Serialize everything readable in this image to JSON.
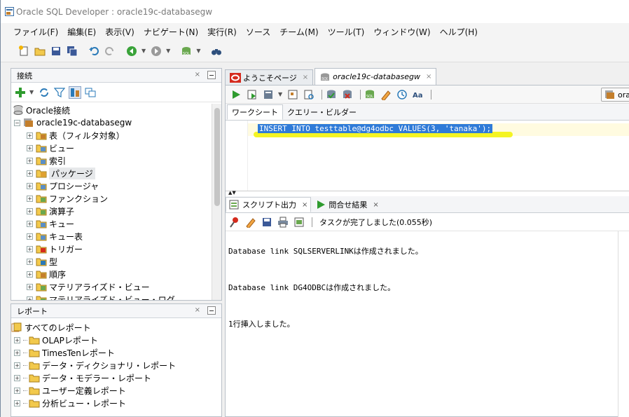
{
  "window": {
    "title": "Oracle SQL Developer : oracle19c-databasegw"
  },
  "menubar": [
    "ファイル(F)",
    "編集(E)",
    "表示(V)",
    "ナビゲート(N)",
    "実行(R)",
    "ソース",
    "チーム(M)",
    "ツール(T)",
    "ウィンドウ(W)",
    "ヘルプ(H)"
  ],
  "connections_panel": {
    "title": "接続",
    "close": "×",
    "root": "Oracle接続",
    "connection": "oracle19c-databasegw",
    "items": [
      "表（フィルタ対象）",
      "ビュー",
      "索引",
      "パッケージ",
      "プロシージャ",
      "ファンクション",
      "演算子",
      "キュー",
      "キュー表",
      "トリガー",
      "型",
      "順序",
      "マテリアライズド・ビュー",
      "マテリアライズド・ビュー・ログ"
    ],
    "selected_item": "パッケージ"
  },
  "reports_panel": {
    "title": "レポート",
    "close": "×",
    "root": "すべてのレポート",
    "items": [
      "OLAPレポート",
      "TimesTenレポート",
      "データ・ディクショナリ・レポート",
      "データ・モデラー・レポート",
      "ユーザー定義レポート",
      "分析ビュー・レポート"
    ]
  },
  "doc_tabs": [
    {
      "label": "ようこそページ",
      "close": "×"
    },
    {
      "label": "oracle19c-databasegw",
      "close": "×"
    }
  ],
  "editor": {
    "connection_label": "ora",
    "subtabs": [
      "ワークシート",
      "クエリー・ビルダー"
    ],
    "sql": "INSERT INTO testtable@dg4odbc VALUES(3, 'tanaka');"
  },
  "output_tabs": [
    {
      "label": "スクリプト出力",
      "close": "×"
    },
    {
      "label": "問合せ結果",
      "close": "×"
    }
  ],
  "output": {
    "status": "タスクが完了しました(0.055秒)",
    "lines": [
      "Database link SQLSERVERLINKは作成されました。",
      "Database link DG4ODBCは作成されました。",
      "1行挿入しました。"
    ]
  }
}
